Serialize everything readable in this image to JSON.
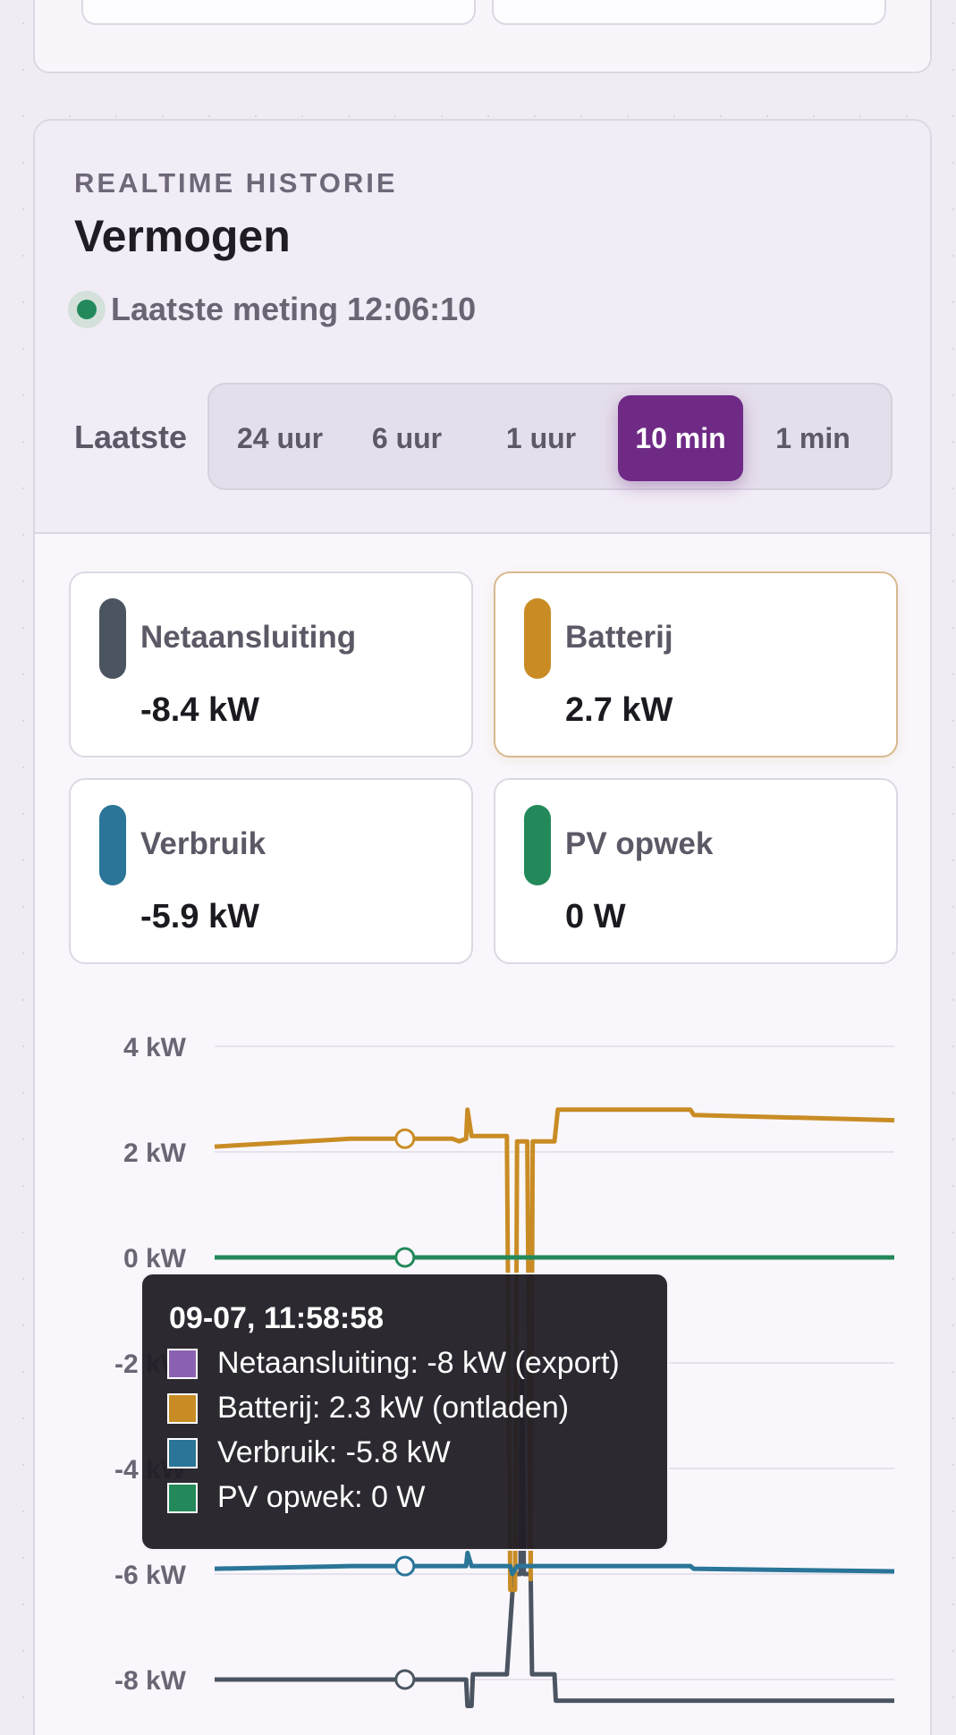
{
  "card": {
    "eyebrow": "REALTIME HISTORIE",
    "title": "Vermogen",
    "status_text": "Laatste meting 12:06:10",
    "range_label": "Laatste",
    "ranges": [
      {
        "label": "24 uur",
        "active": false
      },
      {
        "label": "6 uur",
        "active": false
      },
      {
        "label": "1 uur",
        "active": false
      },
      {
        "label": "10 min",
        "active": true
      },
      {
        "label": "1 min",
        "active": false
      }
    ]
  },
  "metrics": [
    {
      "label": "Netaansluiting",
      "value": "-8.4 kW",
      "color": "#4b5561"
    },
    {
      "label": "Batterij",
      "value": "2.7 kW",
      "color": "#c98c25"
    },
    {
      "label": "Verbruik",
      "value": "-5.9 kW",
      "color": "#2a7598"
    },
    {
      "label": "PV opwek",
      "value": "0 W",
      "color": "#23895a"
    }
  ],
  "chart_data": {
    "type": "line",
    "ylim": [
      -8.6,
      4.2
    ],
    "y_ticks": [
      "4 kW",
      "2 kW",
      "0 kW",
      "-2 kW",
      "-4 kW",
      "-6 kW",
      "-8 kW"
    ],
    "grid": true,
    "x_unit": "minutes in 10-minute window",
    "series": [
      {
        "name": "Netaansluiting",
        "color": "#4b5561",
        "points": [
          [
            0,
            -8.0
          ],
          [
            3.5,
            -8.0
          ],
          [
            3.7,
            -8.0
          ],
          [
            3.72,
            -8.5
          ],
          [
            3.78,
            -8.5
          ],
          [
            3.8,
            -7.9
          ],
          [
            4.3,
            -7.9
          ],
          [
            4.4,
            -6.0
          ],
          [
            4.5,
            -6.0
          ],
          [
            4.52,
            -1.8
          ],
          [
            4.55,
            -6.0
          ],
          [
            4.65,
            -6.0
          ],
          [
            4.67,
            -7.9
          ],
          [
            5.0,
            -7.9
          ],
          [
            5.02,
            -8.4
          ],
          [
            6.0,
            -8.4
          ],
          [
            8.0,
            -8.4
          ],
          [
            10.0,
            -8.4
          ]
        ]
      },
      {
        "name": "Batterij",
        "color": "#c98c25",
        "points": [
          [
            0,
            2.1
          ],
          [
            2.0,
            2.25
          ],
          [
            3.5,
            2.25
          ],
          [
            3.6,
            2.2
          ],
          [
            3.7,
            2.25
          ],
          [
            3.72,
            2.8
          ],
          [
            3.78,
            2.3
          ],
          [
            4.3,
            2.3
          ],
          [
            4.35,
            -6.3
          ],
          [
            4.42,
            -6.3
          ],
          [
            4.45,
            2.2
          ],
          [
            4.6,
            2.2
          ],
          [
            4.65,
            -6.1
          ],
          [
            4.68,
            2.2
          ],
          [
            5.0,
            2.2
          ],
          [
            5.05,
            2.8
          ],
          [
            7.0,
            2.8
          ],
          [
            7.05,
            2.7
          ],
          [
            10.0,
            2.6
          ]
        ]
      },
      {
        "name": "Verbruik",
        "color": "#2a7598",
        "points": [
          [
            0,
            -5.9
          ],
          [
            2.0,
            -5.85
          ],
          [
            3.7,
            -5.85
          ],
          [
            3.72,
            -5.6
          ],
          [
            3.78,
            -5.85
          ],
          [
            4.35,
            -5.85
          ],
          [
            4.38,
            -6.0
          ],
          [
            4.45,
            -5.85
          ],
          [
            7.0,
            -5.85
          ],
          [
            7.05,
            -5.9
          ],
          [
            10.0,
            -5.95
          ]
        ]
      },
      {
        "name": "PV opwek",
        "color": "#23895a",
        "points": [
          [
            0,
            0
          ],
          [
            10.0,
            0
          ]
        ]
      }
    ],
    "hover_x": 2.8
  },
  "tooltip": {
    "title": "09-07, 11:58:58",
    "rows": [
      {
        "text": "Netaansluiting: -8 kW (export)",
        "color": "#8b62b3"
      },
      {
        "text": "Batterij: 2.3 kW (ontladen)",
        "color": "#c98c25"
      },
      {
        "text": "Verbruik: -5.8 kW",
        "color": "#2a7598"
      },
      {
        "text": "PV opwek: 0 W",
        "color": "#23895a"
      }
    ]
  }
}
